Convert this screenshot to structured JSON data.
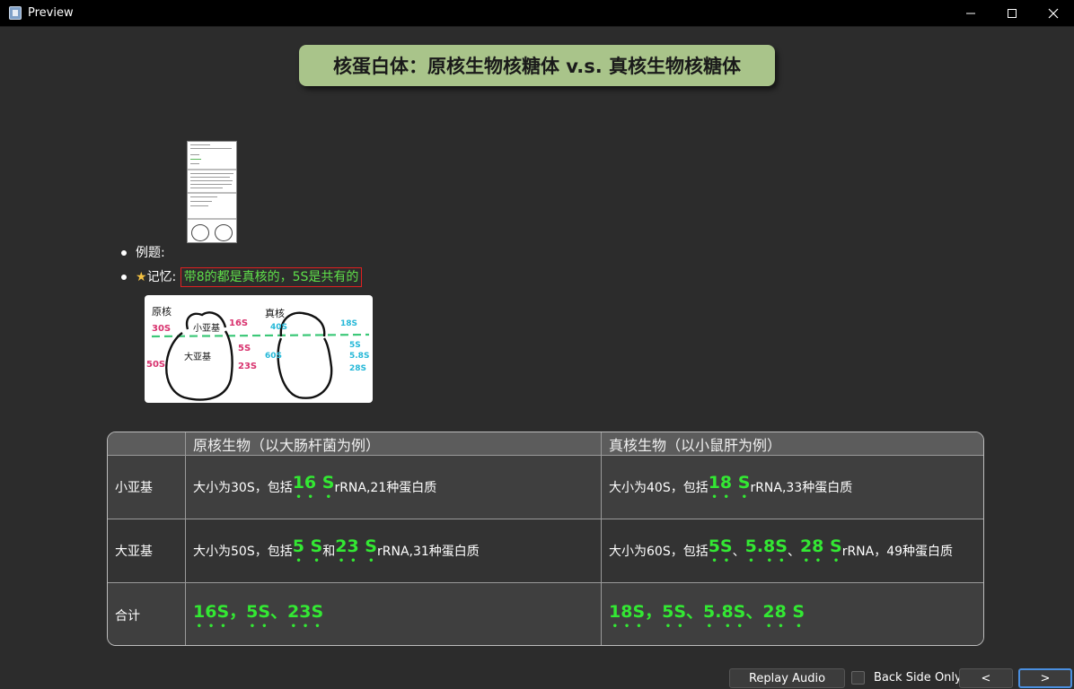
{
  "window": {
    "title": "Preview"
  },
  "card": {
    "title": "核蛋白体：原核生物核糖体 v.s. 真核生物核糖体",
    "bullets": {
      "example_label": "例题:",
      "memory_star": "★",
      "memory_label": "记忆:",
      "memory_text": "带8的都是真核的，5S是共有的"
    },
    "diagram": {
      "prok_label": "原核",
      "euk_label": "真核",
      "small_subunit": "小亚基",
      "large_subunit": "大亚基",
      "p_small_size": "30S",
      "p_large_size": "50S",
      "p_small_rrna": "16S",
      "p_large_rrna_1": "5S",
      "p_large_rrna_2": "23S",
      "e_small_size": "40S",
      "e_large_size": "60S",
      "e_small_rrna": "18S",
      "e_large_rrna_1": "5S",
      "e_large_rrna_2": "5.8S",
      "e_large_rrna_3": "28S"
    },
    "table": {
      "headers": [
        "",
        "原核生物（以大肠杆菌为例）",
        "真核生物（以小鼠肝为例）"
      ],
      "rows": [
        {
          "label": "小亚基",
          "prok": {
            "pre": "大小为30S，包括",
            "em1": "16 S",
            "post": " rRNA,21种蛋白质"
          },
          "euk": {
            "pre": "大小为40S，包括",
            "em1": "18 S",
            "post": " rRNA,33种蛋白质"
          }
        },
        {
          "label": "大亚基",
          "prok": {
            "pre": "大小为50S，包括",
            "em1": "5 S",
            "mid": "和",
            "em2": "23 S",
            "post": " rRNA,31种蛋白质"
          },
          "euk": {
            "pre": "大小为60S，包括",
            "em1": "5S",
            "sep1": "、",
            "em2": "5.8S",
            "sep2": "、",
            "em3": "28 S",
            "post": " rRNA，49种蛋白质"
          }
        },
        {
          "label": "合计",
          "prok": {
            "em1": "16S，5S、23S"
          },
          "euk": {
            "em1": "18S，5S、5.8S、28 S"
          }
        }
      ]
    }
  },
  "controls": {
    "replay_audio": "Replay Audio",
    "back_side_only": "Back Side Only",
    "prev": "<",
    "next": ">"
  },
  "colors": {
    "title_bg": "#a9c48a",
    "emphasis_green": "#33e833",
    "memo_border": "#e02020",
    "memo_text": "#5fe04a",
    "diagram_pink": "#d8326e",
    "diagram_cyan": "#25b8d8",
    "diagram_dash": "#3cc878"
  }
}
